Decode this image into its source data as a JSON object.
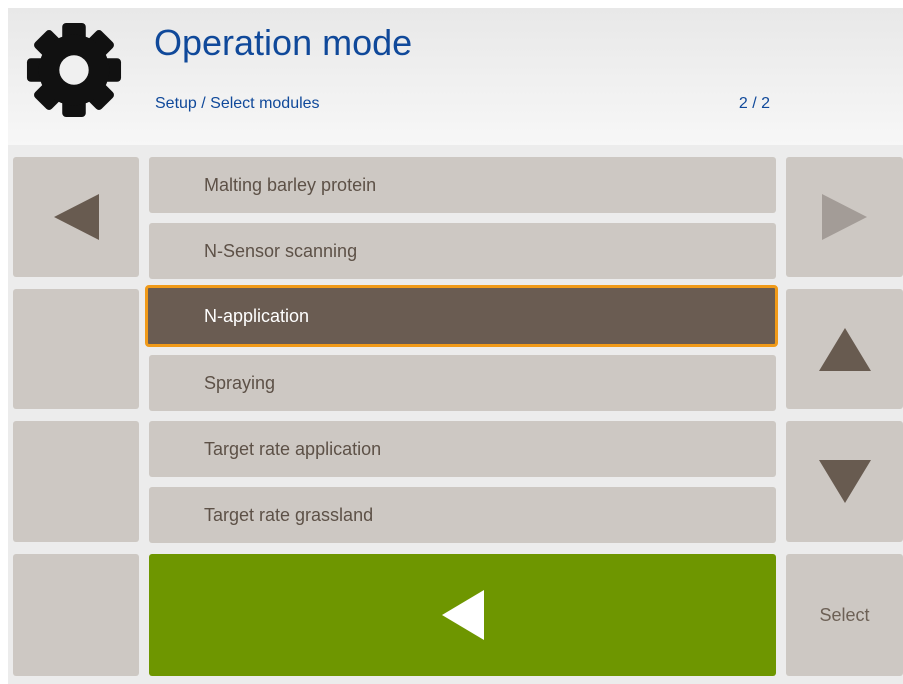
{
  "header": {
    "title": "Operation mode",
    "breadcrumb": "Setup / Select modules",
    "page_indicator": "2 / 2",
    "icon": "gear-icon"
  },
  "list": {
    "items": [
      {
        "label": "Malting barley protein",
        "selected": false
      },
      {
        "label": "N-Sensor scanning",
        "selected": false
      },
      {
        "label": "N-application",
        "selected": true
      },
      {
        "label": "Spraying",
        "selected": false
      },
      {
        "label": "Target rate application",
        "selected": false
      },
      {
        "label": "Target rate grassland",
        "selected": false
      }
    ]
  },
  "softkeys": {
    "left": [
      "arrow-left-icon",
      "",
      "",
      ""
    ],
    "right": [
      "arrow-right-icon",
      "arrow-up-icon",
      "arrow-down-icon",
      "Select"
    ],
    "select_label": "Select"
  },
  "back_button": {
    "icon": "back-arrow-icon"
  },
  "colors": {
    "title": "#10499a",
    "key_background": "#cdc8c3",
    "selected_background": "#6a5c52",
    "selection_border": "#f09a19",
    "back_button": "#6e9600"
  }
}
